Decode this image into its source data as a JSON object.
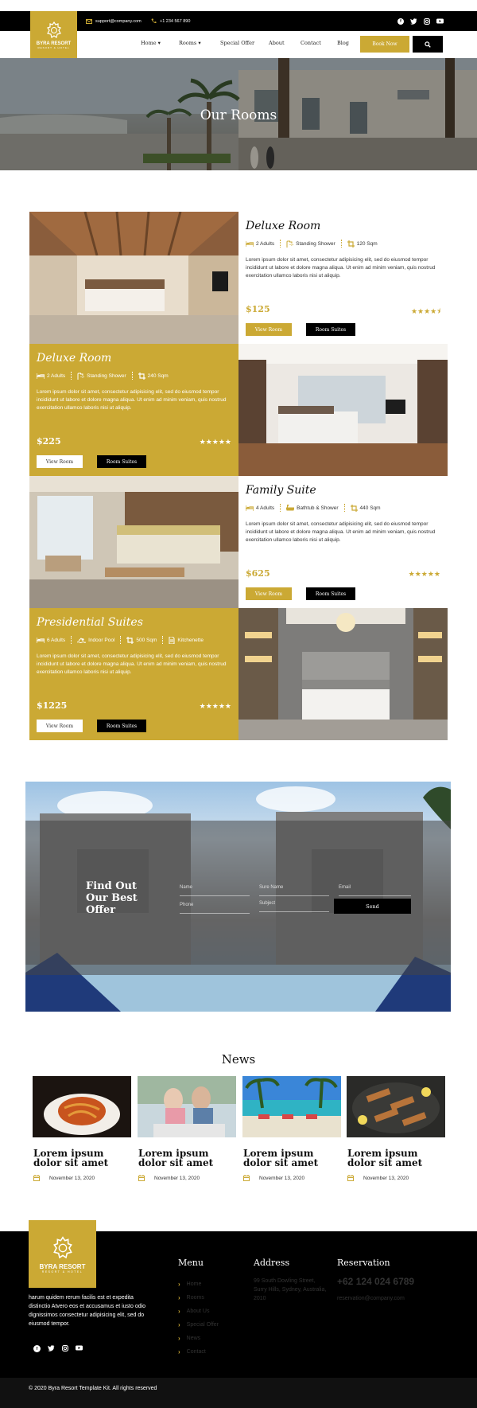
{
  "topbar": {
    "email": "support@company.com",
    "phone": "+1 234 567 890",
    "socials": [
      "facebook-icon",
      "twitter-icon",
      "instagram-icon",
      "youtube-icon"
    ]
  },
  "brand": {
    "name": "BYRA RESORT",
    "tagline": "RESORT & HOTEL"
  },
  "nav": {
    "items": [
      "Home",
      "Rooms",
      "Special Offer",
      "About",
      "Contact",
      "Blog"
    ],
    "book_now": "Book Now"
  },
  "hero": {
    "title": "Our Rooms"
  },
  "rooms": [
    {
      "title": "Deluxe Room",
      "features": [
        "2 Adults",
        "Standing Shower",
        "120 Sqm"
      ],
      "description": "Lorem ipsum dolor sit amet, consectetur adipisicing elit, sed do eiusmod tempor incididunt ut labore et dolore magna aliqua. Ut enim ad minim veniam, quis nostrud exercitation ullamco laboris nisi ut aliquip.",
      "price": "$125",
      "rating": 4.5,
      "stars": "★★★★⯨",
      "view_label": "View Room",
      "suites_label": "Room Suites"
    },
    {
      "title": "Deluxe Room",
      "features": [
        "2 Adults",
        "Standing Shower",
        "240 Sqm"
      ],
      "description": "Lorem ipsum dolor sit amet, consectetur adipisicing elit, sed do eiusmod tempor incididunt ut labore et dolore magna aliqua. Ut enim ad minim veniam, quis nostrud exercitation ullamco laboris nisi ut aliquip.",
      "price": "$225",
      "rating": 5,
      "stars": "★★★★★",
      "view_label": "View Room",
      "suites_label": "Room Suites"
    },
    {
      "title": "Family Suite",
      "features": [
        "4 Adults",
        "Bathtub & Shower",
        "440 Sqm"
      ],
      "description": "Lorem ipsum dolor sit amet, consectetur adipisicing elit, sed do eiusmod tempor incididunt ut labore et dolore magna aliqua. Ut enim ad minim veniam, quis nostrud exercitation ullamco laboris nisi ut aliquip.",
      "price": "$625",
      "rating": 5,
      "stars": "★★★★★",
      "view_label": "View Room",
      "suites_label": "Room Suites"
    },
    {
      "title": "Presidential Suites",
      "features": [
        "6 Adults",
        "Indoor Pool",
        "500 Sqm",
        "Kitchenette"
      ],
      "description": "Lorem ipsum dolor sit amet, consectetur adipisicing elit, sed do eiusmod tempor incididunt ut labore et dolore magna aliqua. Ut enim ad minim veniam, quis nostrud exercitation ullamco laboris nisi ut aliquip.",
      "price": "$1225",
      "rating": 5,
      "stars": "★★★★★",
      "view_label": "View Room",
      "suites_label": "Room Suites"
    }
  ],
  "offer": {
    "title": "Find Out Our Best Offer",
    "fields": {
      "name": "Name",
      "surename": "Sure Name",
      "email": "Email",
      "phone": "Phone",
      "subject": "Subject"
    },
    "send": "Send"
  },
  "news": {
    "heading": "News",
    "items": [
      {
        "title": "Lorem ipsum dolor sit amet",
        "date": "November 13, 2020",
        "image": "pasta-dish"
      },
      {
        "title": "Lorem ipsum dolor sit amet",
        "date": "November 13, 2020",
        "image": "couple-dining"
      },
      {
        "title": "Lorem ipsum dolor sit amet",
        "date": "November 13, 2020",
        "image": "beach-resort"
      },
      {
        "title": "Lorem ipsum dolor sit amet",
        "date": "November 13, 2020",
        "image": "skewers-platter"
      }
    ]
  },
  "footer": {
    "about": "harum quidem rerum facilis est et expedita distinctio Atvero eos et accusamus et iusto odio dignissimos consectetur adipisicing elit, sed do eiusmod tempor.",
    "menu_heading": "Menu",
    "menu": [
      "Home",
      "Rooms",
      "About Us",
      "Special Offer",
      "News",
      "Contact"
    ],
    "address_heading": "Address",
    "address": "99 South Dowling Street, Surry Hills, Sydney, Australia, 2010",
    "reservation_heading": "Reservation",
    "phone": "+62 124 024 6789",
    "email": "reservation@company.com",
    "copyright": "© 2020 Byra Resort Template Kit. All rights reserved"
  },
  "colors": {
    "accent": "#cba934",
    "dark": "#000000"
  }
}
